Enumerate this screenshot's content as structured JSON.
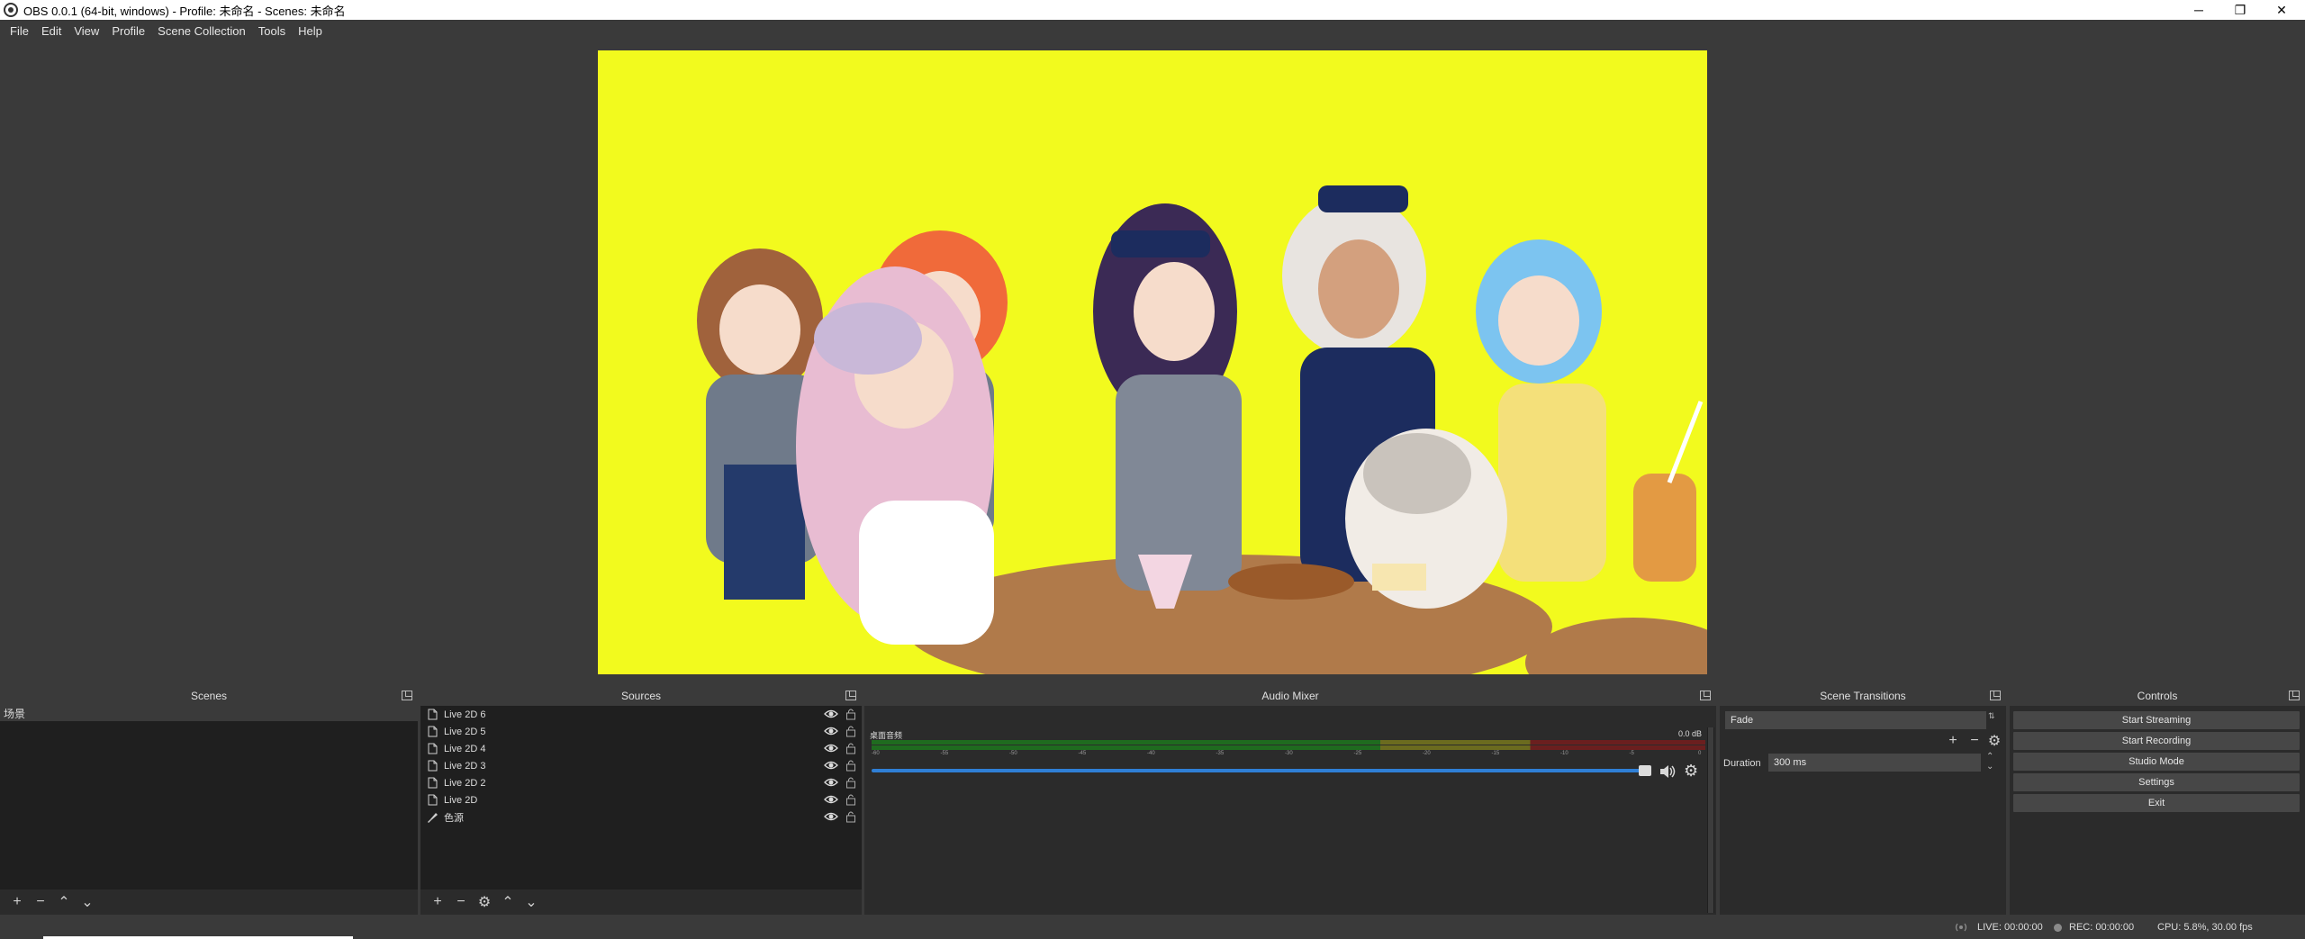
{
  "window": {
    "title": "OBS 0.0.1 (64-bit, windows) - Profile: 未命名 - Scenes: 未命名",
    "minimize": "─",
    "restore": "❐",
    "close": "✕"
  },
  "menu": [
    "File",
    "Edit",
    "View",
    "Profile",
    "Scene Collection",
    "Tools",
    "Help"
  ],
  "preview": {
    "background": "#f2fa1e"
  },
  "scenes": {
    "title": "Scenes",
    "items": [
      "场景"
    ]
  },
  "sources": {
    "title": "Sources",
    "items": [
      "Live 2D 6",
      "Live 2D 5",
      "Live 2D 4",
      "Live 2D 3",
      "Live 2D 2",
      "Live 2D",
      "色源"
    ]
  },
  "mixer": {
    "title": "Audio Mixer",
    "track_name": "桌面音频",
    "db": "0.0 dB",
    "ticks": [
      "-60",
      "-55",
      "-50",
      "-45",
      "-40",
      "-35",
      "-30",
      "-25",
      "-20",
      "-15",
      "-10",
      "-5",
      "0"
    ]
  },
  "transitions": {
    "title": "Scene Transitions",
    "selected": "Fade",
    "duration_label": "Duration",
    "duration_value": "300 ms"
  },
  "controls": {
    "title": "Controls",
    "start_streaming": "Start Streaming",
    "start_recording": "Start Recording",
    "studio_mode": "Studio Mode",
    "settings": "Settings",
    "exit": "Exit"
  },
  "status": {
    "live": "LIVE: 00:00:00",
    "rec": "REC: 00:00:00",
    "cpu": "CPU: 5.8%, 30.00 fps"
  },
  "icons": {
    "add": "+",
    "remove": "−",
    "up": "⌃",
    "down": "⌄",
    "gear": "⚙"
  }
}
